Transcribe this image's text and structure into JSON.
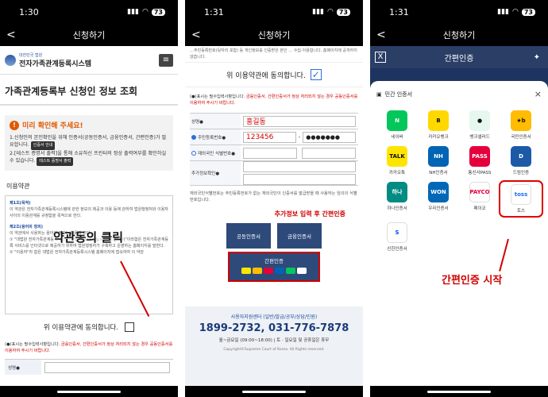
{
  "status": {
    "time": "1:30",
    "time2": "1:31",
    "time3": "1:31",
    "battery": "73"
  },
  "nav": {
    "title": "신청하기",
    "back": "<"
  },
  "screen1": {
    "logo_small": "대한민국 법원",
    "logo_big": "전자가족관계등록시스템",
    "menu": "≡",
    "page_title": "가족관계등록부 신청인 정보 조회",
    "notice_icon": "!",
    "notice_title": "미리 확인해 주세요!",
    "notice_1a": "1.신청인의 본인확인을 위해 인증서(공동인증서, 금융인증서, 간편인증)가 필요합니다.",
    "notice_1_btn": "인증서 안내",
    "notice_2a": "2.[테스트 증명서 출력]을 통해 소유하신 프린터의 정상 출력여부를 확인하실 수 있습니다.",
    "notice_2_btn": "테스트 증명서 출력",
    "section_terms": "이용약관",
    "terms_h1": "제1조(목적)",
    "terms_p1": "이 약관은 전자가족관계등록시스템에 관한 정보의 제공과 이용 등에 관하여 법원행정처와 이용자 사이의 이용관계를 규정함을 목적으로 한다.",
    "terms_h2": "제2조(용어의 정의)",
    "terms_p2": "이 약관에서 사용하는 용어의 정의는 다음과 같다.",
    "terms_p3": "① \"대법원 전자가족관계등록시스템(https://efamily.scourt.go.kr)\"이라함은 전자가족관계등록 서비스를 인터넷으로 제공하기 위하여 법원행정처가 구축하고 운영하는 홈페이지를 말한다.",
    "terms_p4": "② \"이용자\"라 함은 대법원 전자가족관계등록시스템 홈페이지에 접속하여 이 약관",
    "overlay": "약관동의 클릭",
    "agree": "위 이용약관에 동의합니다.",
    "note_a": "(●)표시는 필수입력사항입니다.",
    "note_b": "금융인증서, 간편인증서가 정상 처리되지 않는 경우 공동인증서를 이용하여 주시기 바랍니다.",
    "form_label": "성명●"
  },
  "screen2": {
    "top_text": "…주민등록번호(뒷자리 포함) 등 개인정보를 인증받은 본인 … 수집·이용합니다. 홈페이지에 공개하지 않습니다.",
    "agree": "위 이용약관에 동의합니다.",
    "check": "✓",
    "note_a": "(●)표시는 필수입력사항입니다.",
    "note_b": "금융인증서, 간편인증서가 정상 처리되지 않는 경우 공동인증서를 이용하여 주시기 바랍니다.",
    "label_name": "성명●",
    "value_name": "홍길동",
    "label_rrn": "주민등록번호●",
    "value_rrn1": "123456",
    "dash": "-",
    "value_rrn2": "●●●●●●●",
    "label_foreign": "재외국민 식별번호●",
    "label_extra": "추가정보확인●",
    "warn": "재외국민식별번호는 주민등록번호가 없는 재외국민이 인증서를 발급받을 때 사용하는 임의의 식별번호입니다.",
    "red_caption": "추가정보 입력 후 간편인증",
    "btn_joint": "공동인증서",
    "btn_finance": "금융인증서",
    "btn_simple": "간편인증",
    "footer_center": "사용자지원센터 (일반/발급/공부/상담/민원)",
    "footer_tel": "1899-2732, 031-776-7878",
    "footer_hours": "월~금요일 (09:00~18:00) | 토 · 일요일 및 공휴일은 휴무",
    "footer_copy": "Copyright©Supreme Court of Korea. All Rights reserved."
  },
  "screen3": {
    "title": "간편인증",
    "close": "X",
    "sheet_title": "민간 인증서",
    "sheet_close": "×",
    "apps": [
      {
        "name": "네이버",
        "color": "#03c75a",
        "glyph": "N"
      },
      {
        "name": "카카오뱅크",
        "color": "#ffd800",
        "glyph": "B"
      },
      {
        "name": "뱅크샐러드",
        "color": "#e6f7ef",
        "glyph": "●"
      },
      {
        "name": "국민인증서",
        "color": "#ffbc00",
        "glyph": "★b"
      },
      {
        "name": "카카오톡",
        "color": "#fee500",
        "glyph": "TALK"
      },
      {
        "name": "NH인증서",
        "color": "#0064b4",
        "glyph": "NH"
      },
      {
        "name": "통신사PASS",
        "color": "#e4003b",
        "glyph": "PASS"
      },
      {
        "name": "드림인증",
        "color": "#1c5aa8",
        "glyph": "D"
      },
      {
        "name": "하나인증서",
        "color": "#008c82",
        "glyph": "하나"
      },
      {
        "name": "우리인증서",
        "color": "#0068b7",
        "glyph": "WON"
      },
      {
        "name": "페이코",
        "color": "#ffffff",
        "glyph": "PAYCO"
      },
      {
        "name": "토스",
        "color": "#ffffff",
        "glyph": "toss"
      },
      {
        "name": "신한인증서",
        "color": "#ffffff",
        "glyph": "S"
      }
    ],
    "caption": "간편인증 시작"
  }
}
